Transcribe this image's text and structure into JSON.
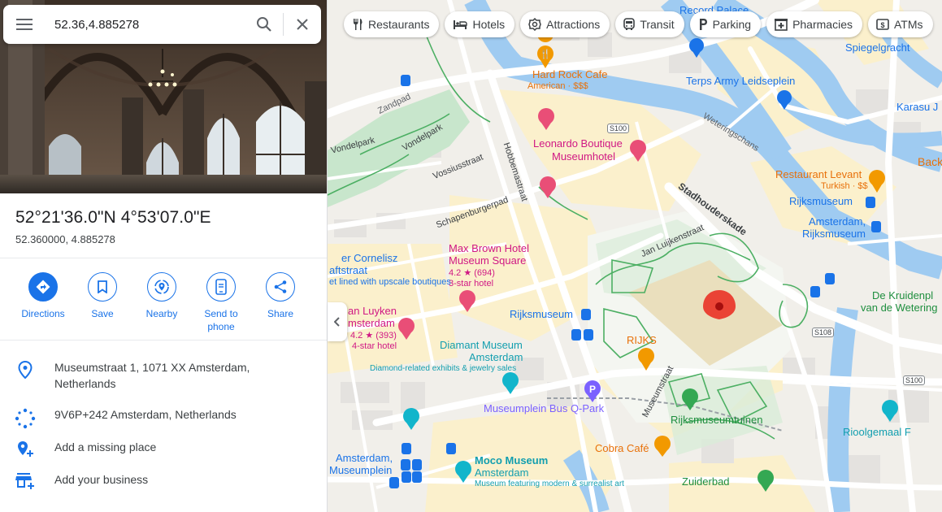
{
  "search": {
    "query": "52.36,4.885278"
  },
  "place": {
    "dms": "52°21'36.0\"N 4°53'07.0\"E",
    "decimal": "52.360000, 4.885278"
  },
  "actions": [
    {
      "label": "Directions",
      "icon": "directions-icon"
    },
    {
      "label": "Save",
      "icon": "bookmark-icon"
    },
    {
      "label": "Nearby",
      "icon": "nearby-icon"
    },
    {
      "label": "Send to",
      "label2": "phone",
      "icon": "send-to-phone-icon"
    },
    {
      "label": "Share",
      "icon": "share-icon"
    }
  ],
  "info": [
    {
      "line1": "Museumstraat 1, 1071 XX Amsterdam,",
      "line2": "Netherlands",
      "icon": "location-pin-icon"
    },
    {
      "line1": "9V6P+242 Amsterdam, Netherlands",
      "icon": "plus-code-icon"
    },
    {
      "line1": "Add a missing place",
      "icon": "add-location-icon"
    },
    {
      "line1": "Add your business",
      "icon": "add-business-icon"
    }
  ],
  "chips": [
    {
      "label": "Restaurants",
      "icon": "fork-knife-icon"
    },
    {
      "label": "Hotels",
      "icon": "bed-icon"
    },
    {
      "label": "Attractions",
      "icon": "camera-icon"
    },
    {
      "label": "Transit",
      "icon": "bus-icon"
    },
    {
      "label": "Parking",
      "icon": "parking-icon"
    },
    {
      "label": "Pharmacies",
      "icon": "pharmacy-icon"
    },
    {
      "label": "ATMs",
      "icon": "atm-icon"
    }
  ],
  "map_labels": {
    "hard_rock": "Hard Rock Cafe",
    "hard_rock_sub": "American · $$$",
    "terps": "Terps Army Leidseplein",
    "spiegelgracht": "Spiegelgracht",
    "record_palace": "Record Palace",
    "karasu": "Karasu J",
    "weteringschans": "Weteringschans",
    "zandpad": "Zandpad",
    "vondelpark1": "Vondelpark",
    "vondelpark2": "Vondelpark",
    "vossiusstraat": "Vossiusstraat",
    "hobbemastraat": "Hobbemastraat",
    "schapenburgerpad": "Schapenburgerpad",
    "s100a": "S100",
    "leonardo1": "Leonardo Boutique",
    "leonardo2": "Museumhotel",
    "restaurant_levant": "Restaurant Levant",
    "levant_sub": "Turkish · $$",
    "back": "Back",
    "rijksmuseum_station": "Rijksmuseum",
    "amsterdam_rijks1": "Amsterdam,",
    "amsterdam_rijks2": "Rijksmuseum",
    "stadhouderskade": "Stadhouderskade",
    "jan_luijkenstraat": "Jan Luijkenstraat",
    "maxbrown1": "Max Brown Hotel",
    "maxbrown2": "Museum Square",
    "maxbrown_rating": "4.2 ★ (694)",
    "maxbrown_class": "3-star hotel",
    "cornelisz1": "er Cornelisz",
    "cornelisz2": "aftstraat",
    "cornelisz3": "et lined with upscale boutiques",
    "vanluyken1": "an Luyken",
    "vanluyken2": "msterdam",
    "vanluyken_rating": "4.2 ★ (393)",
    "vanluyken_class": "4-star hotel",
    "rijksmuseum_stop": "Rijksmuseum",
    "rijks": "RIJKS",
    "kruidentuin1": "De Kruidenpl",
    "kruidentuin2": "van de Wetering",
    "s108": "S108",
    "diamant1": "Diamant Museum",
    "diamant2": "Amsterdam",
    "diamant_sub": "Diamond-related exhibits & jewelry sales",
    "museumplein_bus": "Museumplein Bus Q-Park",
    "museumstraat": "Museumstraat",
    "rijksmuseumtuinen": "Rijksmuseumtuinen",
    "s100b": "S100",
    "rioolgemaal": "Rioolgemaal F",
    "cobra": "Cobra Café",
    "amsterdam_mp1": "Amsterdam,",
    "amsterdam_mp2": "Museumplein",
    "moco1": "Moco Museum",
    "moco2": "Amsterdam",
    "moco_sub": "Museum featuring modern & surrealist art",
    "zuiderbad": "Zuiderbad"
  }
}
